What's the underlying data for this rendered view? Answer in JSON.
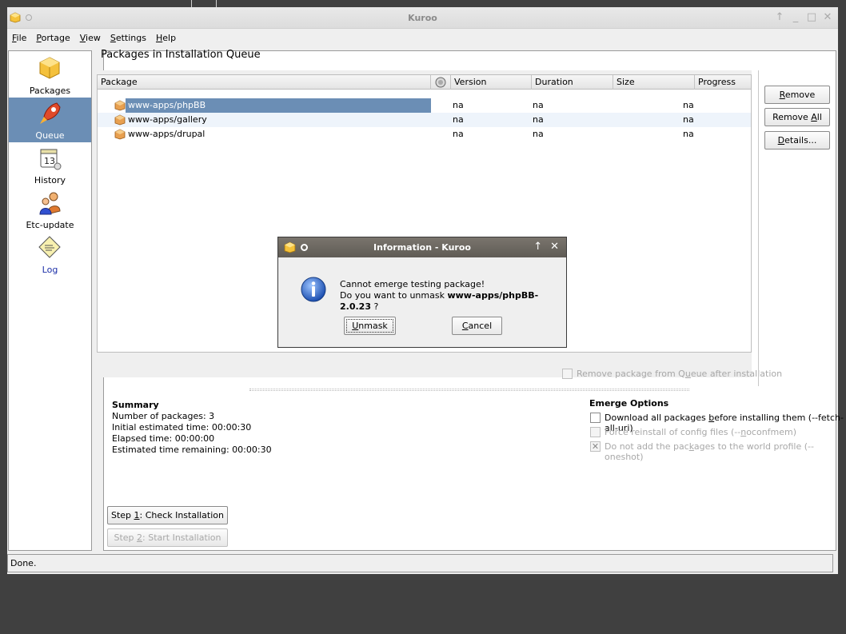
{
  "window": {
    "title": "Kuroo"
  },
  "menu": [
    {
      "pre": "",
      "u": "F",
      "post": "ile"
    },
    {
      "pre": "",
      "u": "P",
      "post": "ortage"
    },
    {
      "pre": "",
      "u": "V",
      "post": "iew"
    },
    {
      "pre": "",
      "u": "S",
      "post": "ettings"
    },
    {
      "pre": "",
      "u": "H",
      "post": "elp"
    }
  ],
  "sidebar": {
    "items": [
      {
        "label": "Packages",
        "icon": "package-icon"
      },
      {
        "label": "Queue",
        "icon": "rocket-icon"
      },
      {
        "label": "History",
        "icon": "calendar-icon"
      },
      {
        "label": "Etc-update",
        "icon": "people-icon"
      },
      {
        "label": "Log",
        "icon": "log-icon"
      }
    ],
    "active": 1
  },
  "main": {
    "title": "Packages in Installation Queue",
    "columns": [
      "Package",
      "",
      "Version",
      "Duration",
      "Size",
      "Progress"
    ],
    "rows": [
      {
        "package": "www-apps/phpBB",
        "version": "na",
        "duration": "na",
        "size": "na",
        "progress": ""
      },
      {
        "package": "www-apps/gallery",
        "version": "na",
        "duration": "na",
        "size": "na",
        "progress": ""
      },
      {
        "package": "www-apps/drupal",
        "version": "na",
        "duration": "na",
        "size": "na",
        "progress": ""
      }
    ],
    "remove_after_install": {
      "pre": "Remove package from Q",
      "u": "u",
      "post": "eue after installation"
    }
  },
  "buttons": {
    "remove": {
      "pre": "",
      "u": "R",
      "post": "emove"
    },
    "remove_all": {
      "pre": "Remove ",
      "u": "A",
      "post": "ll"
    },
    "details": {
      "pre": "",
      "u": "D",
      "post": "etails..."
    },
    "step1": {
      "pre": "Step ",
      "u": "1",
      "post": ": Check Installation"
    },
    "step2": {
      "pre": "Step ",
      "u": "2",
      "post": ": Start Installation"
    }
  },
  "summary": {
    "title": "Summary",
    "lines": [
      "Number of packages: 3",
      "Initial estimated time: 00:00:30",
      "Elapsed time: 00:00:00",
      "Estimated time remaining: 00:00:30"
    ]
  },
  "emerge_options": {
    "title": "Emerge Options",
    "options": [
      {
        "pre": "Download all packages ",
        "u": "b",
        "post": "efore installing them (--fetch-all-uri)",
        "checked": false,
        "enabled": true
      },
      {
        "pre": "Force reinstall of config files (--",
        "u": "n",
        "post": "oconfmem)",
        "checked": false,
        "enabled": false
      },
      {
        "pre": "Do not add the pac",
        "u": "k",
        "post": "ages to the world profile (--oneshot)",
        "checked": true,
        "enabled": false
      }
    ]
  },
  "dialog": {
    "title": "Information - Kuroo",
    "line1": "Cannot emerge testing package!",
    "line2_pre": "Do you want to unmask ",
    "line2_bold": "www-apps/phpBB-2.0.23",
    "line2_post": " ?",
    "unmask": {
      "pre": "",
      "u": "U",
      "post": "nmask"
    },
    "cancel": {
      "pre": "",
      "u": "C",
      "post": "ancel"
    }
  },
  "status": "Done."
}
